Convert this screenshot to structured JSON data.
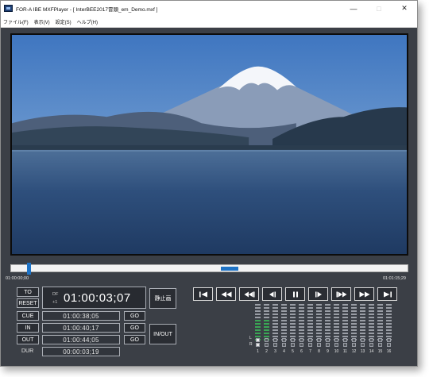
{
  "window": {
    "title": "FOR-A IBE MXFPlayer - [ InterBEE2017冒頭_em_Demo.mxf ]",
    "controls": {
      "minimize": "—",
      "maximize": "□",
      "close": "✕"
    }
  },
  "menu": [
    "ファイル(F)",
    "表示(V)",
    "設定(S)",
    "ヘルプ(H)"
  ],
  "timeline": {
    "start": "01:00:00;00",
    "end": "01:01:15;29",
    "position_fraction": 0.04,
    "mark_fraction": 0.53
  },
  "buttons": {
    "to": "TO",
    "reset": "RESET",
    "cue": "CUE",
    "in": "IN",
    "out": "OUT",
    "dur": "DUR",
    "go": "GO",
    "still": "静止画",
    "in_out": "IN/OUT"
  },
  "timecode": {
    "df": "DF",
    "rate": "+1",
    "current": "01:00:03;07"
  },
  "fields": {
    "cue": "01:00:38;05",
    "in": "01:00:40;17",
    "out": "01:00:44;05",
    "dur": "00:00:03;19"
  },
  "transport": [
    "go-to-start",
    "fast-rewind",
    "rewind",
    "step-back",
    "pause",
    "step-forward",
    "forward",
    "fast-forward",
    "go-to-end"
  ],
  "audio_meters": {
    "channels": [
      "1",
      "2",
      "3",
      "4",
      "5",
      "6",
      "7",
      "8",
      "9",
      "10",
      "11",
      "12",
      "13",
      "14",
      "15",
      "16"
    ],
    "levels": [
      0.55,
      0.55,
      0,
      0,
      0,
      0,
      0,
      0,
      0,
      0,
      0,
      0,
      0,
      0,
      0,
      0
    ],
    "labels": {
      "left": "L",
      "right": "R"
    },
    "active_color": "#3aa655",
    "idle_color": "#9a9ea6"
  }
}
